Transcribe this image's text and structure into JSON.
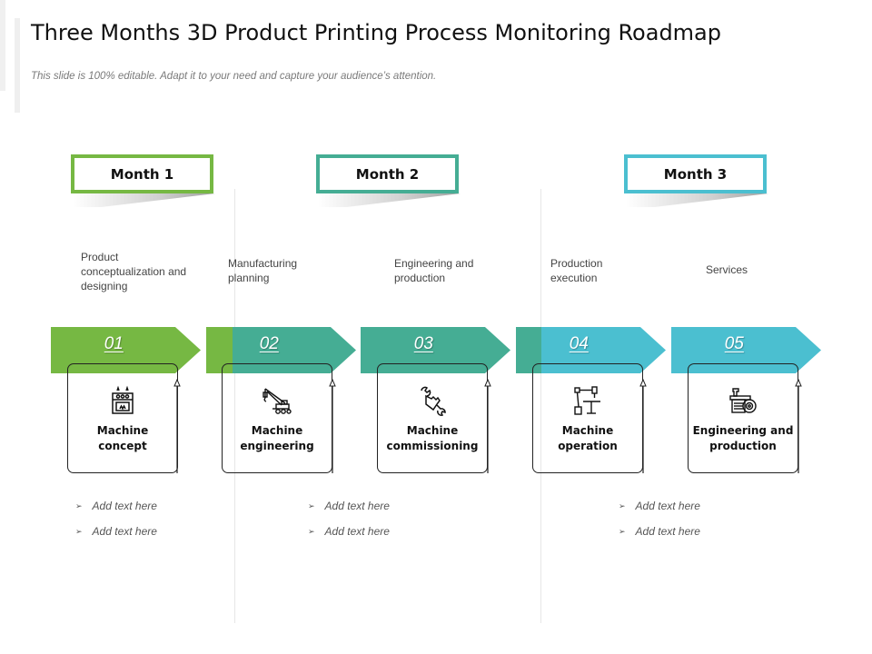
{
  "header": {
    "title": "Three Months 3D Product Printing Process Monitoring Roadmap",
    "subtitle": "This slide is 100% editable. Adapt it to your need and capture your audience’s attention."
  },
  "colors": {
    "green": "#76b843",
    "teal": "#45ad94",
    "cyan": "#4bbfd0"
  },
  "months": [
    {
      "label": "Month 1",
      "color": "#76b843"
    },
    {
      "label": "Month 2",
      "color": "#45ad94"
    },
    {
      "label": "Month 3",
      "color": "#4bbfd0"
    }
  ],
  "phases": [
    "Product conceptualization and designing",
    "Manufacturing planning",
    "Engineering and production",
    "Production execution",
    "Services"
  ],
  "steps": [
    {
      "number": "01",
      "title": "Machine concept",
      "icon": "oven-machine-icon"
    },
    {
      "number": "02",
      "title": "Machine engineering",
      "icon": "crane-icon"
    },
    {
      "number": "03",
      "title": "Machine commissioning",
      "icon": "wrench-hand-icon"
    },
    {
      "number": "04",
      "title": "Machine operation",
      "icon": "robotic-arm-icon"
    },
    {
      "number": "05",
      "title": "Engineering and production",
      "icon": "factory-gear-icon"
    }
  ],
  "bullets": {
    "month1": [
      "Add text here",
      "Add text here"
    ],
    "month2": [
      "Add text here",
      "Add text here"
    ],
    "month3": [
      "Add text here",
      "Add text here"
    ],
    "marker": "➢"
  }
}
